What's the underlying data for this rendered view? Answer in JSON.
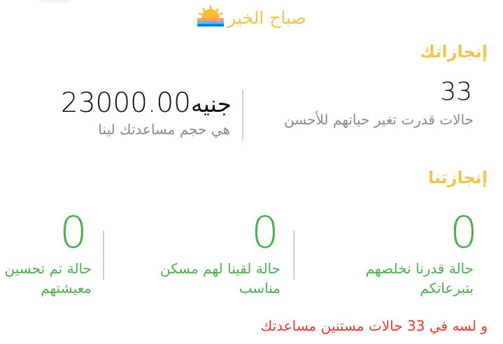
{
  "header": {
    "greeting": "صباح الخير",
    "greeting_icon": "sunrise-icon"
  },
  "achievements": {
    "title": "إنجازاتك",
    "cases_changed": {
      "value": "33",
      "label": "حالات قدرت تغير حياتهم للأحسن"
    },
    "help_amount": {
      "value": "23000.00",
      "currency": "جنيه",
      "label": "هي حجم مساعدتك لينا"
    }
  },
  "our_achievements": {
    "title": "إنجازتنا",
    "stats": [
      {
        "value": "0",
        "label": "حالة قدرنا نخلصهم بتبرعاتكم"
      },
      {
        "value": "0",
        "label": "حالة لقينا لهم مسكن مناسب"
      },
      {
        "value": "0",
        "label": "حالة تم تحسين أوضاع معيشتهم"
      }
    ]
  },
  "remaining_text": "و لسه في 33 حالات مستنين مساعدتك",
  "colors": {
    "gold": "#f0c54e",
    "green": "#4caf50",
    "red": "#e53935",
    "grey": "#8a8a8a"
  }
}
